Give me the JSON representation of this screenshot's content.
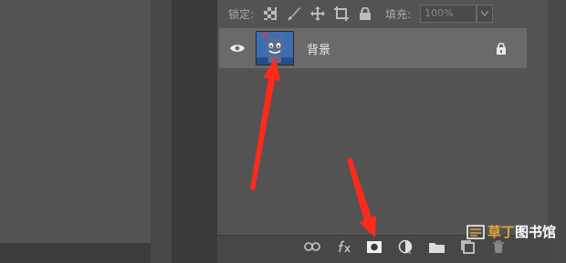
{
  "layers_panel": {
    "lock_label": "锁定:",
    "fill_label": "填充:",
    "fill_value": "100%",
    "layer": {
      "name": "背景"
    }
  },
  "watermark": {
    "text_a": "草丁",
    "text_b": "图书馆"
  },
  "colors": {
    "panel": "#535353",
    "selected_row": "#6a6a6a",
    "arrow": "#ff2a1a"
  }
}
